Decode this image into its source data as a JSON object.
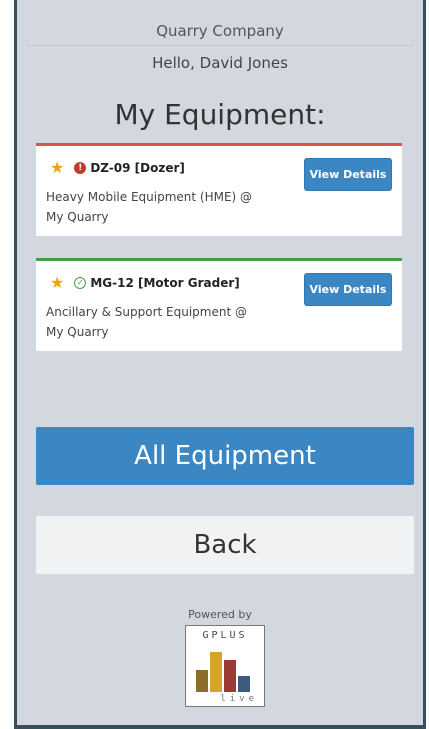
{
  "header": {
    "company": "Quarry Company",
    "greeting": "Hello, David Jones",
    "title": "My Equipment:"
  },
  "equipment": [
    {
      "code": "DZ-09 [Dozer]",
      "status": "alert",
      "status_icon": "alert-icon",
      "status_color": "#c0392b",
      "line1": "Heavy Mobile Equipment (HME) @",
      "line2": "My Quarry",
      "button": "View Details"
    },
    {
      "code": "MG-12 [Motor Grader]",
      "status": "ok",
      "status_icon": "check-circle-icon",
      "status_color": "#43a047",
      "line1": "Ancillary & Support Equipment @",
      "line2": "My Quarry",
      "button": "View Details"
    }
  ],
  "actions": {
    "all_equipment": "All Equipment",
    "back": "Back"
  },
  "footer": {
    "powered_by": "Powered by",
    "logo_top": "GPLUS",
    "logo_bottom": "live"
  },
  "colors": {
    "primary": "#3b87c4",
    "background": "#d3d7df",
    "star": "#f0a30a",
    "alert": "#d9534f",
    "ok": "#43a047"
  }
}
